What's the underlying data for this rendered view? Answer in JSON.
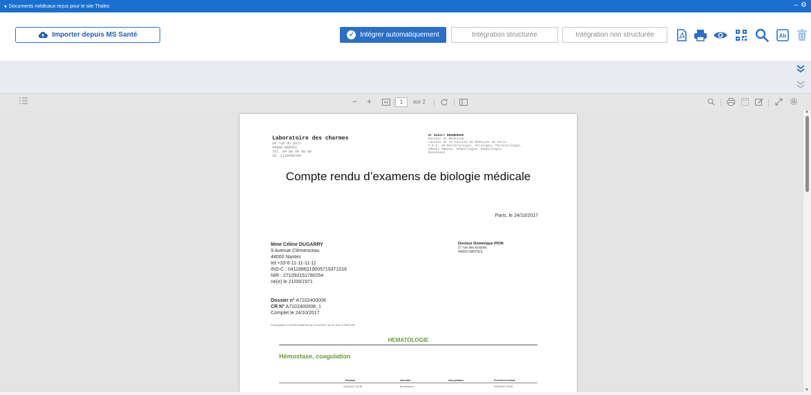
{
  "window": {
    "title": "Documents médicaux reçus pour le site Thales",
    "controls": {
      "minimize": "–",
      "settings": "⚙"
    }
  },
  "toolbar": {
    "import_label": "Importer depuis MS Santé",
    "integrate_auto_label": "Intégrer automatiquement",
    "integrate_structured_label": "Intégration structurée",
    "integrate_unstructured_label": "Intégration non structurée",
    "icons": [
      "pdf-icon",
      "print-icon",
      "eye-icon",
      "qr-code-icon",
      "search-icon",
      "ab-text-icon",
      "trash-icon"
    ]
  },
  "pdf_viewer": {
    "zoom_out": "−",
    "zoom_in": "+",
    "page_current": "1",
    "page_total": "sur 2"
  },
  "document": {
    "lab_name": "Laboratoire des charmes",
    "lab_address": [
      "28 rue du port",
      "44000 NANTES",
      "Tel. 04 00 00 00 00",
      "ID. 1120456789"
    ],
    "doctor_head_name": "Dr Robert BRUNENGUE",
    "doctor_head_lines": [
      "Docteur en Médecine",
      "Lauréat de la Faculté de Médecine de Paris",
      "C.E.S. de Bactériologie, Virologie, Parasitologie,",
      "Hémato-Immuno, Hématologie, Immunologie,",
      "Biochimie"
    ],
    "title": "Compte rendu d’examens de biologie médicale",
    "date_line": "Paris, le 24/10/2017",
    "patient": {
      "name": "Mme Céline DUGARRY",
      "address1": "9 Avenue Clémenceau",
      "address2": "44000 Nantes",
      "tel": "tel:+33-6-11-11-11-11",
      "ins": "INS-C : 0411886319605719371016",
      "nir": "NIR : 271093151780254",
      "born": "né(e) le 21/09/1971"
    },
    "doctor": {
      "name": "Docteur Dominique PION",
      "address1": "27 rue des Erables",
      "address2": "44000 NANTES"
    },
    "dossier": {
      "dossier_label": "Dossier n°",
      "dossier_value": " A7102400008",
      "cr_label": "CR N°",
      "cr_value": " A7102400008_1",
      "complet": "Complet le 24/10/2017"
    },
    "prescription": "Prescription n°2010515456789 du 21/10/2017 du Dr Eve GYNECON",
    "section_main": "HEMATOLOGIE",
    "section_sub": "Hémostase, coagulation",
    "table_headers": [
      "Résultat",
      "Intervalle",
      "Interprétation",
      "Précédent résultat"
    ],
    "table_values": [
      "24/10/2017 14:30",
      "de référence",
      "",
      "22/09/2017 09:45"
    ]
  },
  "colors": {
    "primary": "#2a6fc9",
    "titlebar": "#1a6fd1",
    "section_green": "#6b9a3a"
  }
}
